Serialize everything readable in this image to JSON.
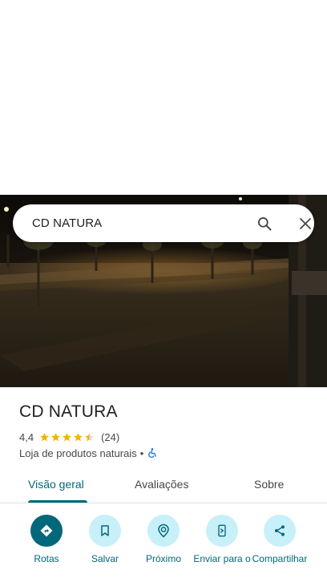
{
  "search": {
    "query": "CD NATURA"
  },
  "place": {
    "name": "CD NATURA",
    "rating": "4,4",
    "review_count": "(24)",
    "stars_value": 4.4,
    "category": "Loja de produtos naturais",
    "separator": "•"
  },
  "tabs": [
    {
      "label": "Visão geral",
      "active": true
    },
    {
      "label": "Avaliações",
      "active": false
    },
    {
      "label": "Sobre",
      "active": false
    }
  ],
  "actions": [
    {
      "label": "Rotas",
      "icon": "directions-icon"
    },
    {
      "label": "Salvar",
      "icon": "bookmark-icon"
    },
    {
      "label": "Próximo",
      "icon": "nearby-icon"
    },
    {
      "label": "Enviar para o",
      "icon": "send-to-phone-icon"
    },
    {
      "label": "Compartilhar",
      "icon": "share-icon"
    }
  ],
  "colors": {
    "accent": "#00687a",
    "action_bg": "#c8f0f9",
    "star": "#f5b400",
    "accessibility": "#1a73e8"
  }
}
